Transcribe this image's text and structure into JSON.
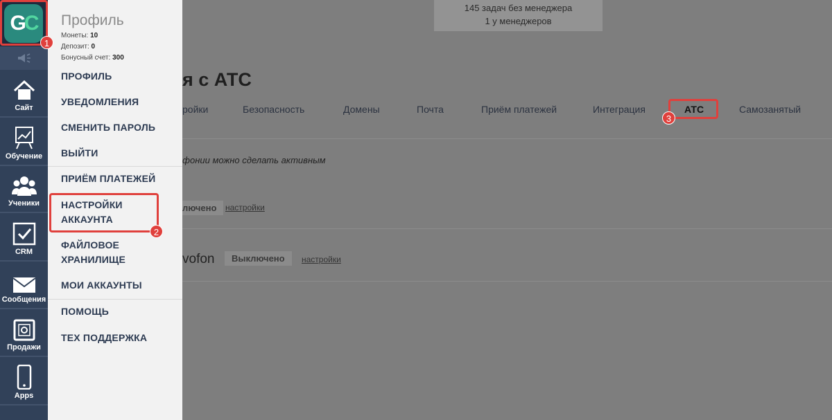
{
  "sidebar": {
    "logo_letter1": "G",
    "logo_letter2": "C",
    "items": [
      {
        "label": "Сайт",
        "icon": "home-icon"
      },
      {
        "label": "Обучение",
        "icon": "chart-board-icon"
      },
      {
        "label": "Ученики",
        "icon": "users-icon"
      },
      {
        "label": "CRM",
        "icon": "checkbox-icon"
      },
      {
        "label": "Сообщения",
        "icon": "envelope-icon"
      },
      {
        "label": "Продажи",
        "icon": "safe-icon"
      },
      {
        "label": "Apps",
        "icon": "phone-icon"
      }
    ]
  },
  "profile_menu": {
    "title": "Профиль",
    "balances": [
      {
        "label": "Монеты:",
        "value": "10"
      },
      {
        "label": "Депозит:",
        "value": "0"
      },
      {
        "label": "Бонусный счет:",
        "value": "300"
      }
    ],
    "items": [
      "Профиль",
      "Уведомления",
      "Сменить пароль",
      "Выйти",
      "Приём платежей",
      "Настройки аккаунта",
      "Файловое хранилище",
      "Мои аккаунты",
      "Помощь",
      "Тех поддержка"
    ]
  },
  "header": {
    "stats_line1": "145 задач без менеджера",
    "stats_line2": "1 у менеджеров"
  },
  "page": {
    "title": "я с АТС",
    "tabs": [
      "ройки",
      "Безопасность",
      "Домены",
      "Почта",
      "Приём платежей",
      "Интеграция",
      "АТС",
      "Самозанятый"
    ],
    "active_tab": "АТС",
    "hint": "фонии можно сделать активным",
    "providers": [
      {
        "name": "",
        "status": "лючено",
        "settings": "настройки"
      },
      {
        "name": "vofon",
        "status": "Выключено",
        "settings": "настройки"
      }
    ]
  },
  "annotations": {
    "markers": [
      "1",
      "2",
      "3"
    ],
    "color": "#e0403c"
  }
}
